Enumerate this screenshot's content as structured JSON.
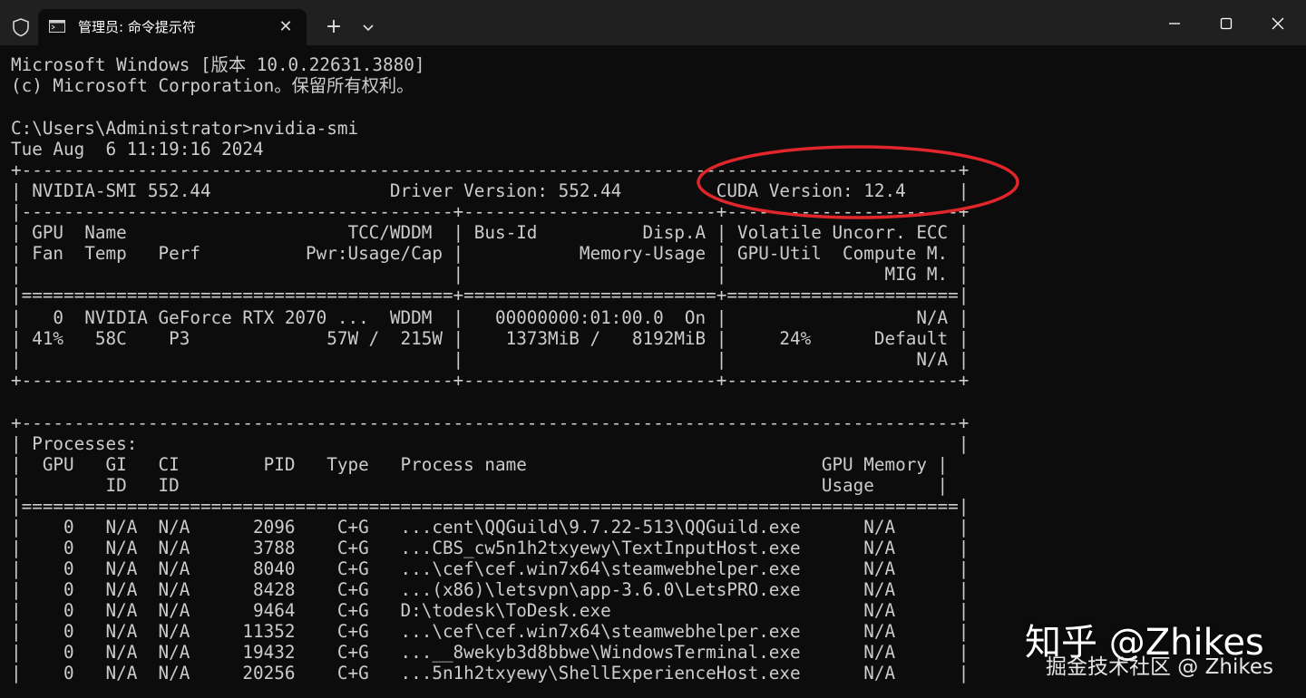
{
  "window": {
    "tab_title": "管理员: 命令提示符",
    "tab_close_glyph": "✕",
    "new_tab_glyph": "+",
    "icons": [
      "shield-icon",
      "terminal-icon",
      "close-icon",
      "plus-icon",
      "chevron-down-icon",
      "minimize-icon",
      "maximize-icon",
      "close-icon"
    ]
  },
  "terminal": {
    "header": [
      "Microsoft Windows [版本 10.0.22631.3880]",
      "(c) Microsoft Corporation。保留所有权利。"
    ],
    "prompt": "C:\\Users\\Administrator>nvidia-smi",
    "timestamp": "Tue Aug  6 11:19:16 2024",
    "gpu_table": [
      "+-----------------------------------------------------------------------------------------+",
      "| NVIDIA-SMI 552.44                 Driver Version: 552.44         CUDA Version: 12.4     |",
      "|-----------------------------------------+------------------------+----------------------+",
      "| GPU  Name                     TCC/WDDM  | Bus-Id          Disp.A | Volatile Uncorr. ECC |",
      "| Fan  Temp   Perf          Pwr:Usage/Cap |           Memory-Usage | GPU-Util  Compute M. |",
      "|                                         |                        |               MIG M. |",
      "|=========================================+========================+======================|",
      "|   0  NVIDIA GeForce RTX 2070 ...  WDDM  |   00000000:01:00.0  On |                  N/A |",
      "| 41%   58C    P3             57W /  215W |    1373MiB /   8192MiB |     24%      Default |",
      "|                                         |                        |                  N/A |",
      "+-----------------------------------------+------------------------+----------------------+"
    ],
    "process_table": [
      "+-----------------------------------------------------------------------------------------+",
      "| Processes:                                                                              |",
      "|  GPU   GI   CI        PID   Type   Process name                            GPU Memory |",
      "|        ID   ID                                                             Usage      |",
      "|=========================================================================================|",
      "|    0   N/A  N/A      2096    C+G   ...cent\\QQGuild\\9.7.22-513\\QQGuild.exe      N/A      |",
      "|    0   N/A  N/A      3788    C+G   ...CBS_cw5n1h2txyewy\\TextInputHost.exe      N/A      |",
      "|    0   N/A  N/A      8040    C+G   ...\\cef\\cef.win7x64\\steamwebhelper.exe      N/A      |",
      "|    0   N/A  N/A      8428    C+G   ...(x86)\\letsvpn\\app-3.6.0\\LetsPRO.exe      N/A      |",
      "|    0   N/A  N/A      9464    C+G   D:\\todesk\\ToDesk.exe                        N/A      |",
      "|    0   N/A  N/A     11352    C+G   ...\\cef\\cef.win7x64\\steamwebhelper.exe      N/A      |",
      "|    0   N/A  N/A     19432    C+G   ...__8wekyb3d8bbwe\\WindowsTerminal.exe      N/A      |",
      "|    0   N/A  N/A     20256    C+G   ...5n1h2txyewy\\ShellExperienceHost.exe      N/A      |"
    ]
  },
  "annotation": {
    "highlight": "CUDA Version: 12.4",
    "color": "#e0262b"
  },
  "watermark": {
    "main": "知乎 @Zhikes",
    "sub": "掘金技术社区 @ Zhikes"
  },
  "colors": {
    "background": "#0c0c0c",
    "titlebar": "#202020",
    "text": "#cccccc"
  }
}
